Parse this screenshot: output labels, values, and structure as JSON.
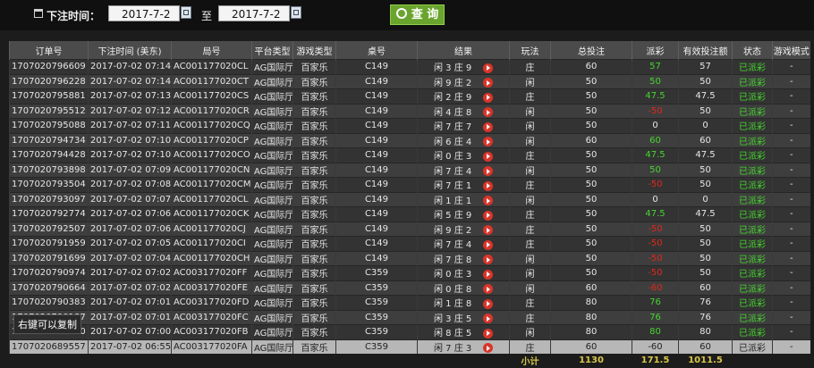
{
  "filter": {
    "label": "下注时间：",
    "from_date": "2017-7-2",
    "to_label": "至",
    "to_date": "2017-7-2",
    "query_label": "查 询"
  },
  "table": {
    "headers": [
      "订单号",
      "下注时间 (美东)",
      "局号",
      "平台类型",
      "游戏类型",
      "桌号",
      "结果",
      "玩法",
      "总投注",
      "派彩",
      "有效投注额",
      "状态",
      "游戏模式"
    ],
    "rows": [
      {
        "order": "1707020796609",
        "time": "2017-07-02 07:14",
        "round": "AC001177020CL",
        "platform": "AG国际厅",
        "game": "百家乐",
        "table": "C149",
        "result": "闲 3 庄 9",
        "play": "庄",
        "bet": "60",
        "payout": "57",
        "payout_color": "green",
        "valid": "57",
        "status": "已派彩",
        "mode": "-"
      },
      {
        "order": "1707020796228",
        "time": "2017-07-02 07:14",
        "round": "AC001177020CT",
        "platform": "AG国际厅",
        "game": "百家乐",
        "table": "C149",
        "result": "闲 9 庄 2",
        "play": "闲",
        "bet": "50",
        "payout": "50",
        "payout_color": "green",
        "valid": "50",
        "status": "已派彩",
        "mode": "-"
      },
      {
        "order": "1707020795881",
        "time": "2017-07-02 07:13",
        "round": "AC001177020CS",
        "platform": "AG国际厅",
        "game": "百家乐",
        "table": "C149",
        "result": "闲 2 庄 9",
        "play": "庄",
        "bet": "50",
        "payout": "47.5",
        "payout_color": "green",
        "valid": "47.5",
        "status": "已派彩",
        "mode": "-"
      },
      {
        "order": "1707020795512",
        "time": "2017-07-02 07:12",
        "round": "AC001177020CR",
        "platform": "AG国际厅",
        "game": "百家乐",
        "table": "C149",
        "result": "闲 4 庄 8",
        "play": "闲",
        "bet": "50",
        "payout": "-50",
        "payout_color": "red",
        "valid": "50",
        "status": "已派彩",
        "mode": "-"
      },
      {
        "order": "1707020795088",
        "time": "2017-07-02 07:11",
        "round": "AC001177020CQ",
        "platform": "AG国际厅",
        "game": "百家乐",
        "table": "C149",
        "result": "闲 7 庄 7",
        "play": "闲",
        "bet": "50",
        "payout": "0",
        "payout_color": "white",
        "valid": "0",
        "status": "已派彩",
        "mode": "-"
      },
      {
        "order": "1707020794734",
        "time": "2017-07-02 07:10",
        "round": "AC001177020CP",
        "platform": "AG国际厅",
        "game": "百家乐",
        "table": "C149",
        "result": "闲 6 庄 4",
        "play": "闲",
        "bet": "60",
        "payout": "60",
        "payout_color": "green",
        "valid": "60",
        "status": "已派彩",
        "mode": "-"
      },
      {
        "order": "1707020794428",
        "time": "2017-07-02 07:10",
        "round": "AC001177020CO",
        "platform": "AG国际厅",
        "game": "百家乐",
        "table": "C149",
        "result": "闲 0 庄 3",
        "play": "庄",
        "bet": "50",
        "payout": "47.5",
        "payout_color": "green",
        "valid": "47.5",
        "status": "已派彩",
        "mode": "-"
      },
      {
        "order": "1707020793898",
        "time": "2017-07-02 07:09",
        "round": "AC001177020CN",
        "platform": "AG国际厅",
        "game": "百家乐",
        "table": "C149",
        "result": "闲 7 庄 4",
        "play": "闲",
        "bet": "50",
        "payout": "50",
        "payout_color": "green",
        "valid": "50",
        "status": "已派彩",
        "mode": "-"
      },
      {
        "order": "1707020793504",
        "time": "2017-07-02 07:08",
        "round": "AC001177020CM",
        "platform": "AG国际厅",
        "game": "百家乐",
        "table": "C149",
        "result": "闲 7 庄 1",
        "play": "庄",
        "bet": "50",
        "payout": "-50",
        "payout_color": "red",
        "valid": "50",
        "status": "已派彩",
        "mode": "-"
      },
      {
        "order": "1707020793097",
        "time": "2017-07-02 07:07",
        "round": "AC001177020CL",
        "platform": "AG国际厅",
        "game": "百家乐",
        "table": "C149",
        "result": "闲 1 庄 1",
        "play": "闲",
        "bet": "50",
        "payout": "0",
        "payout_color": "white",
        "valid": "0",
        "status": "已派彩",
        "mode": "-"
      },
      {
        "order": "1707020792774",
        "time": "2017-07-02 07:06",
        "round": "AC001177020CK",
        "platform": "AG国际厅",
        "game": "百家乐",
        "table": "C149",
        "result": "闲 5 庄 9",
        "play": "庄",
        "bet": "50",
        "payout": "47.5",
        "payout_color": "green",
        "valid": "47.5",
        "status": "已派彩",
        "mode": "-"
      },
      {
        "order": "1707020792507",
        "time": "2017-07-02 07:06",
        "round": "AC001177020CJ",
        "platform": "AG国际厅",
        "game": "百家乐",
        "table": "C149",
        "result": "闲 9 庄 2",
        "play": "庄",
        "bet": "50",
        "payout": "-50",
        "payout_color": "red",
        "valid": "50",
        "status": "已派彩",
        "mode": "-"
      },
      {
        "order": "1707020791959",
        "time": "2017-07-02 07:05",
        "round": "AC001177020CI",
        "platform": "AG国际厅",
        "game": "百家乐",
        "table": "C149",
        "result": "闲 7 庄 4",
        "play": "庄",
        "bet": "50",
        "payout": "-50",
        "payout_color": "red",
        "valid": "50",
        "status": "已派彩",
        "mode": "-"
      },
      {
        "order": "1707020791699",
        "time": "2017-07-02 07:04",
        "round": "AC001177020CH",
        "platform": "AG国际厅",
        "game": "百家乐",
        "table": "C149",
        "result": "闲 7 庄 8",
        "play": "闲",
        "bet": "50",
        "payout": "-50",
        "payout_color": "red",
        "valid": "50",
        "status": "已派彩",
        "mode": "-"
      },
      {
        "order": "1707020790974",
        "time": "2017-07-02 07:02",
        "round": "AC003177020FF",
        "platform": "AG国际厅",
        "game": "百家乐",
        "table": "C359",
        "result": "闲 0 庄 3",
        "play": "闲",
        "bet": "50",
        "payout": "-50",
        "payout_color": "red",
        "valid": "50",
        "status": "已派彩",
        "mode": "-"
      },
      {
        "order": "1707020790664",
        "time": "2017-07-02 07:02",
        "round": "AC003177020FE",
        "platform": "AG国际厅",
        "game": "百家乐",
        "table": "C359",
        "result": "闲 0 庄 8",
        "play": "闲",
        "bet": "60",
        "payout": "-60",
        "payout_color": "red",
        "valid": "60",
        "status": "已派彩",
        "mode": "-"
      },
      {
        "order": "1707020790383",
        "time": "2017-07-02 07:01",
        "round": "AC003177020FD",
        "platform": "AG国际厅",
        "game": "百家乐",
        "table": "C359",
        "result": "闲 1 庄 8",
        "play": "庄",
        "bet": "80",
        "payout": "76",
        "payout_color": "green",
        "valid": "76",
        "status": "已派彩",
        "mode": "-"
      },
      {
        "order": "1707020790187",
        "time": "2017-07-02 07:01",
        "round": "AC003177020FC",
        "platform": "AG国际厅",
        "game": "百家乐",
        "table": "C359",
        "result": "闲 3 庄 5",
        "play": "庄",
        "bet": "80",
        "payout": "76",
        "payout_color": "green",
        "valid": "76",
        "status": "已派彩",
        "mode": "-"
      },
      {
        "order": "1707020789960",
        "time": "2017-07-02 07:00",
        "round": "AC003177020FB",
        "platform": "AG国际厅",
        "game": "百家乐",
        "table": "C359",
        "result": "闲 8 庄 5",
        "play": "闲",
        "bet": "80",
        "payout": "80",
        "payout_color": "green",
        "valid": "80",
        "status": "已派彩",
        "mode": "-"
      },
      {
        "order": "1707020689557",
        "time": "2017-07-02 06:55",
        "round": "AC003177020FA",
        "platform": "AG国际厅",
        "game": "百家乐",
        "table": "C359",
        "result": "闲 7 庄 3",
        "play": "庄",
        "bet": "60",
        "payout": "-60",
        "payout_color": "red",
        "valid": "60",
        "status": "已派彩",
        "mode": "-"
      }
    ],
    "subtotal": {
      "label": "小计",
      "bet": "1130",
      "payout": "171.5",
      "valid": "1011.5"
    }
  },
  "tooltip": "右键可以复制",
  "colors": {
    "payout_positive": "#46d52f",
    "payout_negative": "#e0271c",
    "query_button": "#6aa42e"
  }
}
